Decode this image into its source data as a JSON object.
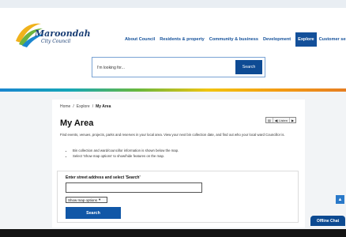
{
  "header": {
    "logo_name": "Maroondah",
    "logo_sub": "City Council",
    "nav": [
      {
        "label": "About Council"
      },
      {
        "label": "Residents & property"
      },
      {
        "label": "Community & business"
      },
      {
        "label": "Development"
      },
      {
        "label": "Explore",
        "active": true
      },
      {
        "label": "Customer service"
      }
    ]
  },
  "search": {
    "placeholder": "I'm looking for...",
    "button_label": "Search"
  },
  "breadcrumb": {
    "home": "Home",
    "sep": "/",
    "parent": "Explore",
    "current": "My Area"
  },
  "page": {
    "title": "My Area",
    "listen": {
      "icon_label": "▤",
      "label": "◀) Listen",
      "play": "▶"
    },
    "intro": "Find events, venues, projects, parks and reserves in your local area. View your next bin collection date, and find out who your local ward Councillor is.",
    "bullets": [
      "Bin collection and ward/councillor information is shown below the map.",
      "Select 'Show map options' to show/hide features on the map."
    ]
  },
  "form": {
    "label": "Enter street address and select 'Search'",
    "address_value": "",
    "map_options": "Show map options",
    "map_options_arrow": "▾",
    "submit_label": "Search"
  },
  "widgets": {
    "scroll_top_glyph": "▲",
    "chat_label": "Offline Chat"
  },
  "colors": {
    "brand": "#13509a",
    "button": "#0e4b94"
  }
}
